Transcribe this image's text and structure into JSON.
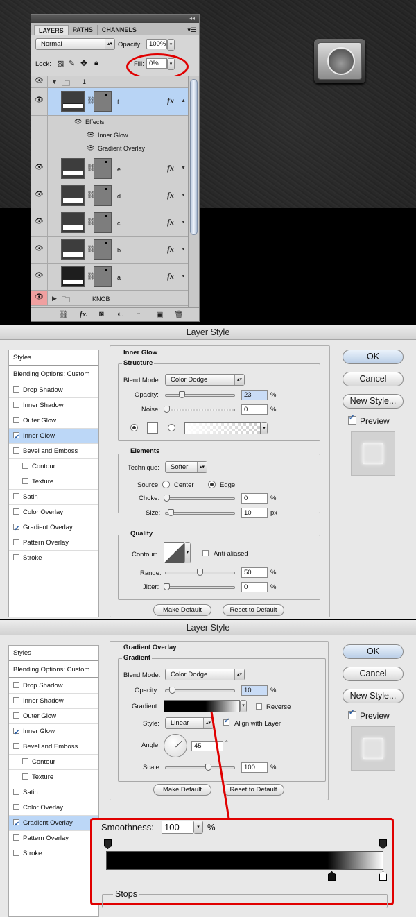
{
  "layers_panel": {
    "tabs": [
      "LAYERS",
      "PATHS",
      "CHANNELS"
    ],
    "blend_mode": "Normal",
    "opacity_label": "Opacity:",
    "opacity_value": "100%",
    "lock_label": "Lock:",
    "fill_label": "Fill:",
    "fill_value": "0%",
    "group_1_name": "1",
    "layers": [
      "f",
      "e",
      "d",
      "c",
      "b",
      "a"
    ],
    "effects_label": "Effects",
    "effect_inner_glow": "Inner Glow",
    "effect_gradient_overlay": "Gradient Overlay",
    "group_knob_name": "KNOB",
    "fx_label": "fx"
  },
  "dialog_common": {
    "title": "Layer Style",
    "styles_header": "Styles",
    "blending_options": "Blending Options: Custom",
    "style_items": [
      "Drop Shadow",
      "Inner Shadow",
      "Outer Glow",
      "Inner Glow",
      "Bevel and Emboss",
      "Contour",
      "Texture",
      "Satin",
      "Color Overlay",
      "Gradient Overlay",
      "Pattern Overlay",
      "Stroke"
    ],
    "ok": "OK",
    "cancel": "Cancel",
    "new_style": "New Style...",
    "preview": "Preview",
    "make_default": "Make Default",
    "reset_default": "Reset to Default"
  },
  "inner_glow": {
    "heading": "Inner Glow",
    "structure": "Structure",
    "blend_mode_label": "Blend Mode:",
    "blend_mode": "Color Dodge",
    "opacity_label": "Opacity:",
    "opacity": "23",
    "noise_label": "Noise:",
    "noise": "0",
    "pct": "%",
    "elements": "Elements",
    "technique_label": "Technique:",
    "technique": "Softer",
    "source_label": "Source:",
    "center": "Center",
    "edge": "Edge",
    "choke_label": "Choke:",
    "choke": "0",
    "size_label": "Size:",
    "size": "10",
    "px": "px",
    "quality": "Quality",
    "contour_label": "Contour:",
    "anti_aliased": "Anti-aliased",
    "range_label": "Range:",
    "range": "50",
    "jitter_label": "Jitter:",
    "jitter": "0"
  },
  "gradient_overlay": {
    "heading": "Gradient Overlay",
    "gradient_group": "Gradient",
    "blend_mode_label": "Blend Mode:",
    "blend_mode": "Color Dodge",
    "opacity_label": "Opacity:",
    "opacity": "10",
    "pct": "%",
    "gradient_label": "Gradient:",
    "reverse": "Reverse",
    "style_label": "Style:",
    "style": "Linear",
    "align": "Align with Layer",
    "angle_label": "Angle:",
    "angle": "45",
    "deg": "°",
    "scale_label": "Scale:",
    "scale": "100"
  },
  "gradient_editor": {
    "smoothness_label": "Smoothness:",
    "smoothness": "100",
    "pct": "%",
    "stops_label": "Stops"
  },
  "colors": {
    "highlight": "#e00000",
    "selection": "#b8d4f5"
  }
}
